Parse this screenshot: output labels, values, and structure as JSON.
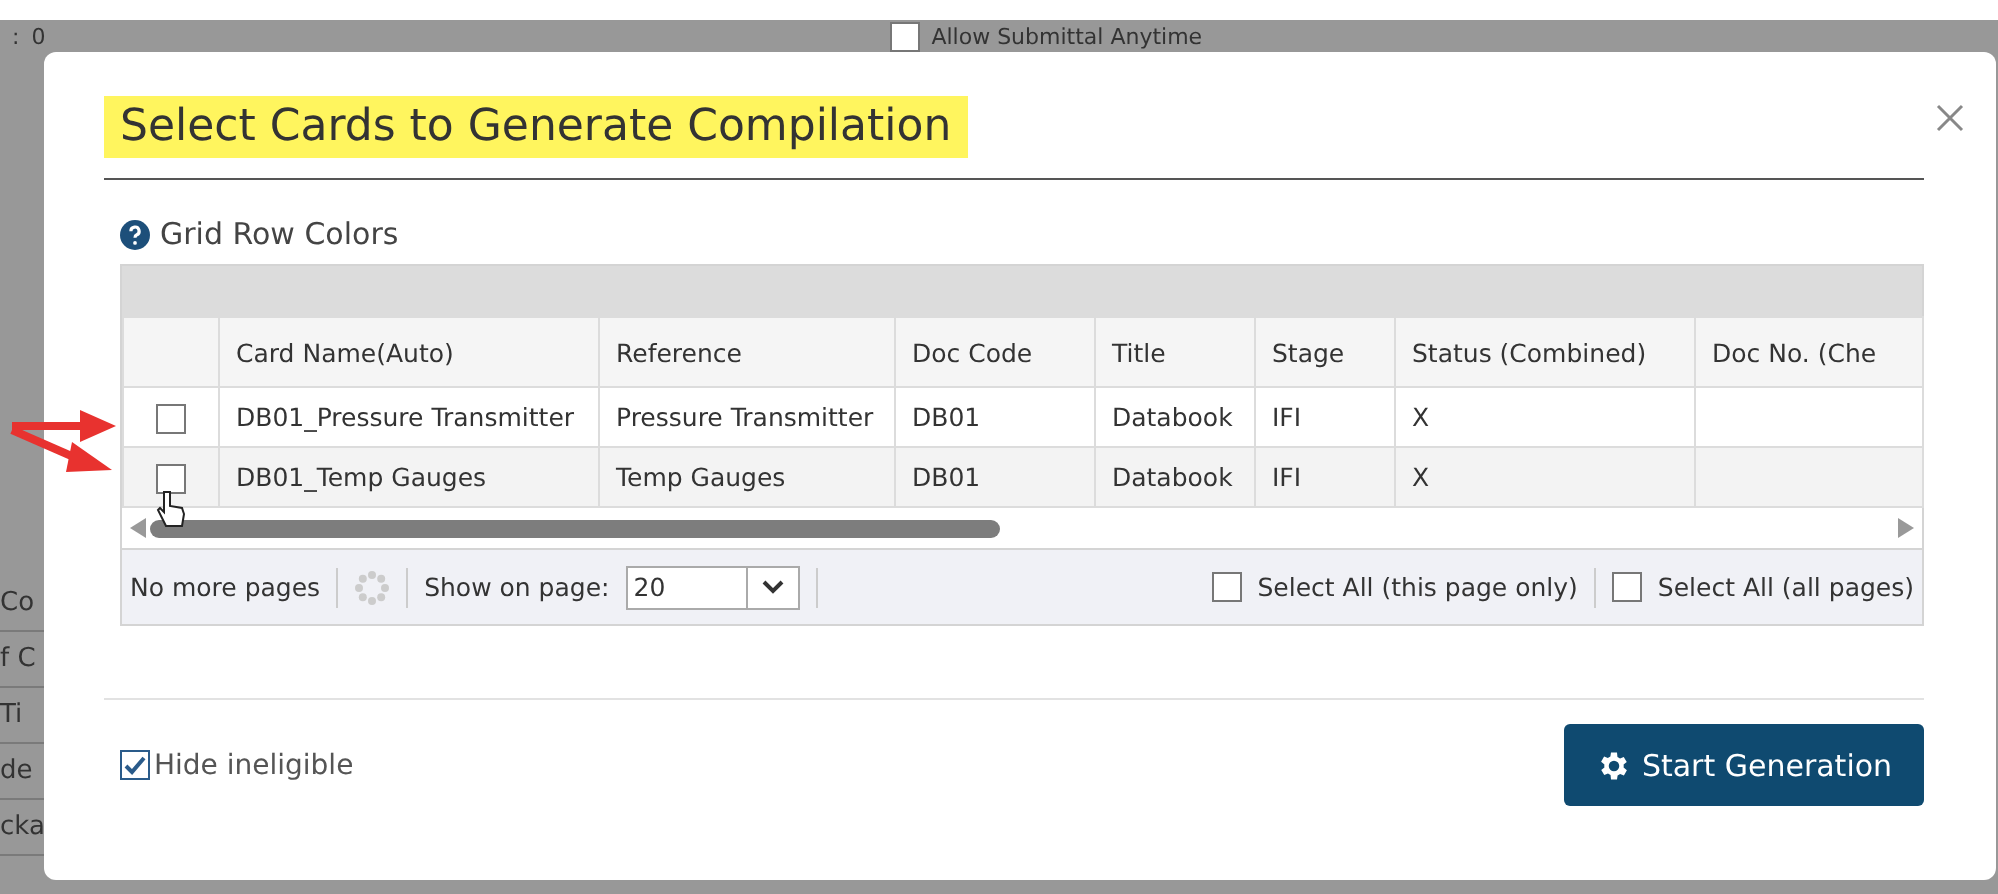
{
  "background": {
    "top_label": ":",
    "top_value": "0",
    "top_checkbox": {
      "label": "Allow Submittal Anytime",
      "checked": false
    },
    "side_fragments": [
      "Co",
      "f C",
      "Ti",
      "de",
      "cka"
    ]
  },
  "dialog": {
    "title": "Select Cards to Generate Compilation",
    "section_title": "Grid Row Colors",
    "columns": [
      "Card Name(Auto)",
      "Reference",
      "Doc Code",
      "Title",
      "Stage",
      "Status (Combined)",
      "Doc No. (Che"
    ],
    "rows": [
      {
        "checked": false,
        "card_name": "DB01_Pressure Transmitter",
        "reference": "Pressure Transmitter",
        "doc_code": "DB01",
        "title": "Databook",
        "stage": "IFI",
        "status": "X"
      },
      {
        "checked": false,
        "card_name": "DB01_Temp Gauges",
        "reference": "Temp Gauges",
        "doc_code": "DB01",
        "title": "Databook",
        "stage": "IFI",
        "status": "X"
      }
    ],
    "footer": {
      "paging": "No more pages",
      "page_size_label": "Show on page:",
      "page_size": "20",
      "select_page": {
        "label": "Select All (this page only)",
        "checked": false
      },
      "select_all": {
        "label": "Select All (all pages)",
        "checked": false
      }
    },
    "hide_ineligible": {
      "label": "Hide ineligible",
      "checked": true
    },
    "start_button": "Start Generation"
  }
}
